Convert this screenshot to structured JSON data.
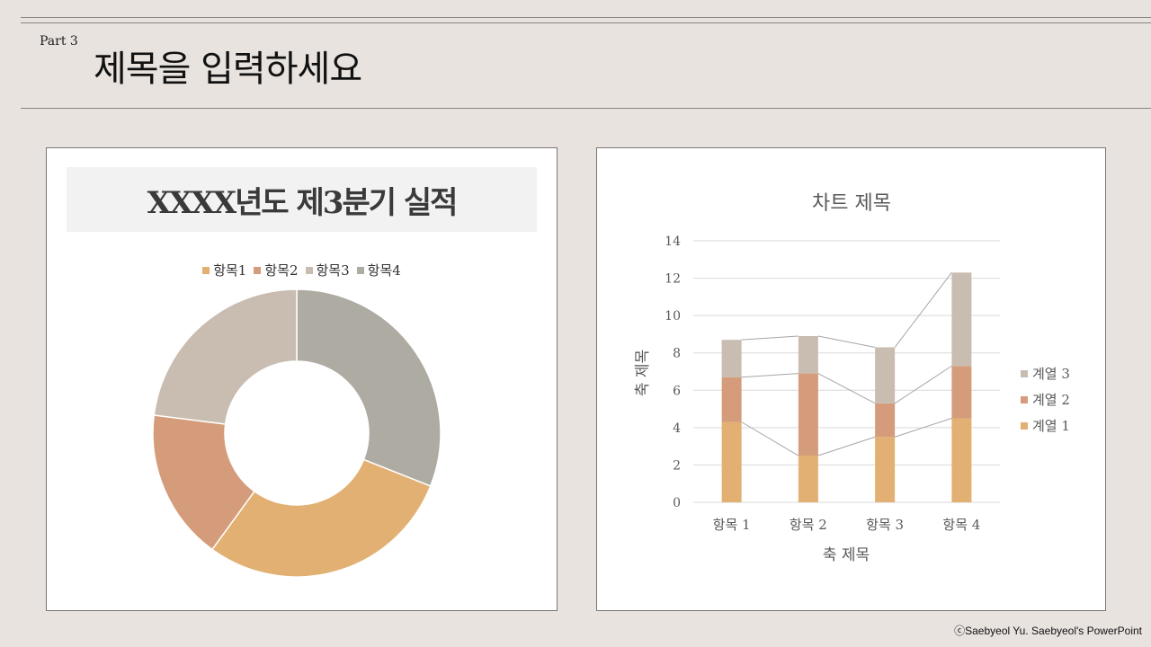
{
  "header": {
    "part_label": "Part 3",
    "title": "제목을 입력하세요"
  },
  "donut": {
    "banner_title": "XXXX년도 제3분기 실적",
    "legend": [
      {
        "label": "항목1",
        "color": "#e2b072"
      },
      {
        "label": "항목2",
        "color": "#d49c7a"
      },
      {
        "label": "항목3",
        "color": "#c9bdb1"
      },
      {
        "label": "항목4",
        "color": "#adaba2"
      }
    ]
  },
  "chart_data": [
    {
      "type": "pie",
      "subtype": "donut",
      "categories": [
        "항목1",
        "항목2",
        "항목3",
        "항목4"
      ],
      "values": [
        29,
        17,
        23,
        31
      ],
      "colors": [
        "#e2b072",
        "#d49c7a",
        "#c9bdb1",
        "#adaba2"
      ],
      "start": "top",
      "direction": "clockwise-from-항목4"
    },
    {
      "type": "bar",
      "subtype": "stacked",
      "title": "차트 제목",
      "xlabel": "축 제목",
      "ylabel": "축 제목",
      "categories": [
        "항목 1",
        "항목 2",
        "항목 3",
        "항목 4"
      ],
      "series": [
        {
          "name": "계열 1",
          "values": [
            4.3,
            2.5,
            3.5,
            4.5
          ],
          "color": "#e2b072"
        },
        {
          "name": "계열 2",
          "values": [
            2.4,
            4.4,
            1.8,
            2.8
          ],
          "color": "#d49c7a"
        },
        {
          "name": "계열 3",
          "values": [
            2.0,
            2.0,
            3.0,
            5.0
          ],
          "color": "#c9bdb1"
        }
      ],
      "ylim": [
        0,
        14
      ],
      "yticks": [
        0,
        2,
        4,
        6,
        8,
        10,
        12,
        14
      ],
      "grid": true,
      "series_lines": true,
      "legend_position": "right"
    }
  ],
  "footer": {
    "credit": "ⓒSaebyeol Yu. Saebyeol's PowerPoint"
  }
}
